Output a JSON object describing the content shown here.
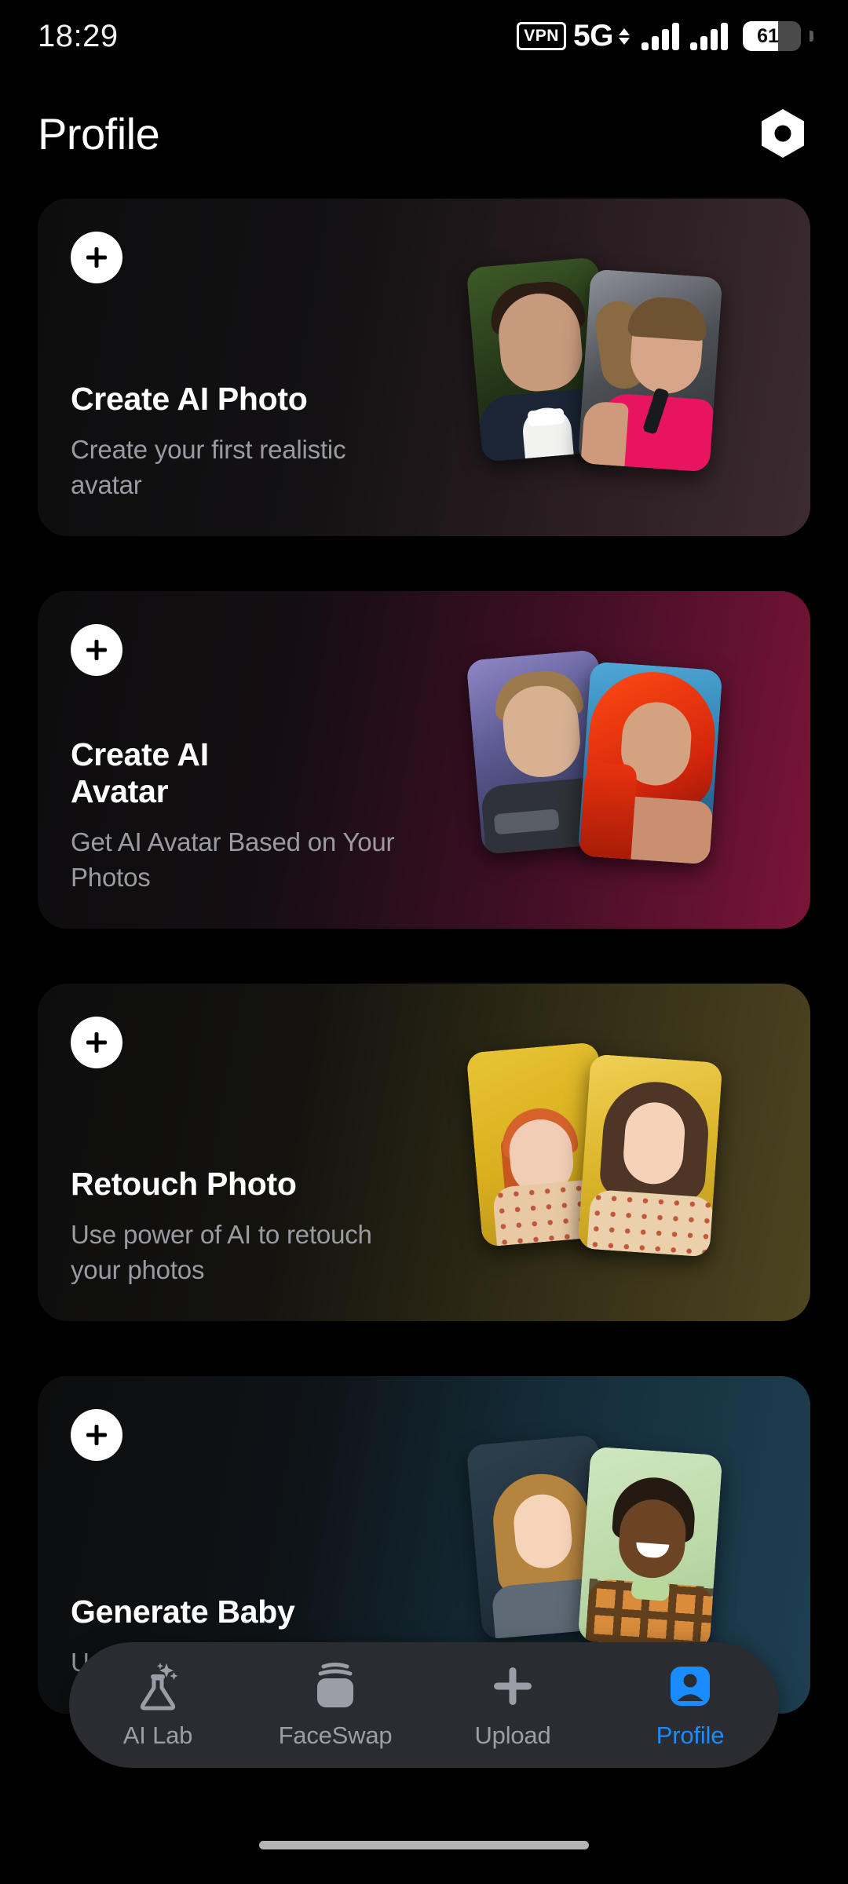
{
  "status_bar": {
    "time": "18:29",
    "vpn_label": "VPN",
    "network": "5G",
    "battery_percent": "61",
    "battery_level": 61,
    "icons": [
      "vpn-badge-icon",
      "network-arrows-icon",
      "signal-bars-icon",
      "signal-bars-icon",
      "battery-icon"
    ]
  },
  "header": {
    "title": "Profile",
    "settings_icon": "hexagon-nut-settings-icon"
  },
  "cards": [
    {
      "title": "Create AI Photo",
      "subtitle": "Create your first realistic avatar",
      "add_icon": "plus-icon",
      "accent_color": "#3c2b31",
      "thumbnails": [
        "man-in-tuxedo-photo",
        "woman-in-pink-sports-bra-photo"
      ]
    },
    {
      "title": "Create AI Avatar",
      "subtitle": "Get AI Avatar Based on Your Photos",
      "add_icon": "plus-icon",
      "accent_color": "#7a1438",
      "thumbnails": [
        "sci-fi-soldier-avatar",
        "red-haired-warrior-avatar"
      ]
    },
    {
      "title": "Retouch Photo",
      "subtitle": "Use power of AI to retouch your photos",
      "add_icon": "plus-icon",
      "accent_color": "#4d4420",
      "thumbnails": [
        "redhead-girl-yellow-backdrop-photo",
        "brunette-woman-yellow-backdrop-photo"
      ]
    },
    {
      "title": "Generate Baby",
      "subtitle": "Use power of AI to se",
      "add_icon": "plus-icon",
      "accent_color": "#1e3f51",
      "thumbnails": [
        "young-girl-photo",
        "young-boy-photo"
      ]
    }
  ],
  "bottom_nav": {
    "active_color": "#1a8cff",
    "inactive_color": "#9b9ea6",
    "items": [
      {
        "label": "AI Lab",
        "icon": "flask-sparkle-icon",
        "active": false
      },
      {
        "label": "FaceSwap",
        "icon": "stacked-cards-icon",
        "active": false
      },
      {
        "label": "Upload",
        "icon": "plus-icon",
        "active": false
      },
      {
        "label": "Profile",
        "icon": "person-icon",
        "active": true
      }
    ]
  }
}
